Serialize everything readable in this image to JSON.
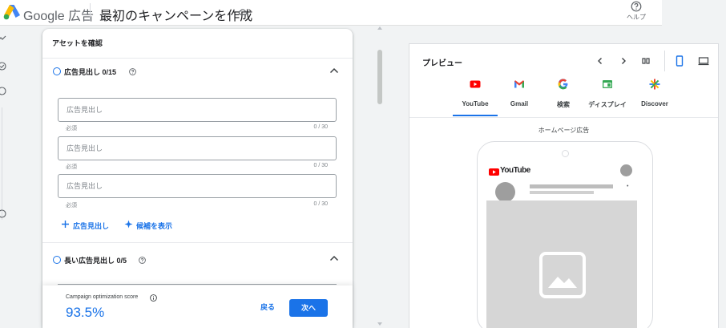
{
  "header": {
    "brand": "Google 広告",
    "title": "最初のキャンペーンを作成",
    "help_label": "ヘルプ"
  },
  "card": {
    "title": "アセットを確認",
    "headlines_section": {
      "label": "広告見出し 0/15"
    },
    "fields": [
      {
        "placeholder": "広告見出し",
        "helper": "必須",
        "counter": "0 / 30"
      },
      {
        "placeholder": "広告見出し",
        "helper": "必須",
        "counter": "0 / 30"
      },
      {
        "placeholder": "広告見出し",
        "helper": "必須",
        "counter": "0 / 30"
      }
    ],
    "add_headline": "広告見出し",
    "show_suggestions": "候補を表示",
    "long_headlines_section": {
      "label": "長い広告見出し 0/5"
    }
  },
  "bottom_bar": {
    "score_label": "Campaign optimization score",
    "score_value": "93.5%",
    "back": "戻る",
    "next": "次へ"
  },
  "preview": {
    "title": "プレビュー",
    "tabs": [
      {
        "label": "YouTube",
        "icon": "youtube-icon",
        "color": "#ff0000"
      },
      {
        "label": "Gmail",
        "icon": "gmail-icon",
        "color": "#ea4335"
      },
      {
        "label": "検索",
        "icon": "google-search-icon",
        "color": "#4285f4"
      },
      {
        "label": "ディスプレイ",
        "icon": "display-icon",
        "color": "#34a853"
      },
      {
        "label": "Discover",
        "icon": "discover-icon",
        "color": "#fbbc04"
      }
    ],
    "selected_tab": "YouTube",
    "caption": "ホームページ広告",
    "youtube_wordmark": "YouTube"
  },
  "colors": {
    "accent": "#1a73e8",
    "youtube_red": "#ff0000"
  }
}
